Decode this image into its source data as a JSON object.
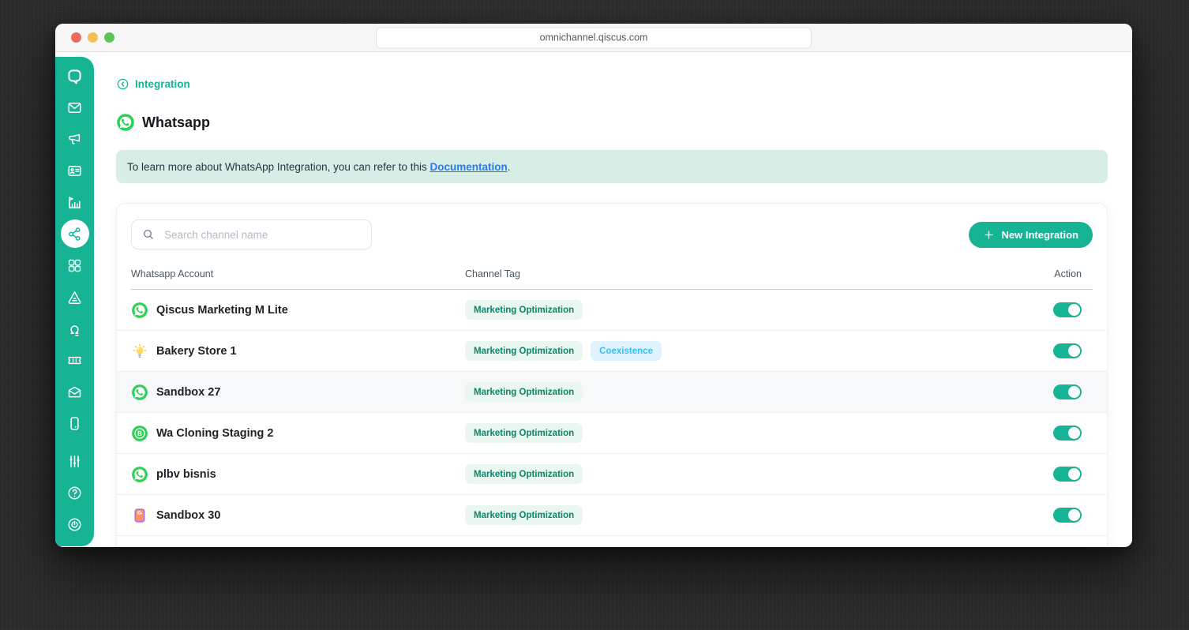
{
  "browser": {
    "url": "omnichannel.qiscus.com"
  },
  "colors": {
    "accent": "#16b394",
    "whatsapp_green": "#2ed157",
    "banner_bg": "#d7eee6",
    "link_blue": "#2879f9"
  },
  "sidebar": {
    "items": [
      {
        "name": "qiscus-logo",
        "group": "top",
        "active": false
      },
      {
        "name": "inbox",
        "group": "top",
        "active": false
      },
      {
        "name": "broadcast",
        "group": "top",
        "active": false
      },
      {
        "name": "contacts",
        "group": "top",
        "active": false
      },
      {
        "name": "analytics",
        "group": "top",
        "active": false
      },
      {
        "name": "integration",
        "group": "top",
        "active": true
      },
      {
        "name": "apps",
        "group": "top",
        "active": false
      },
      {
        "name": "robolabs",
        "group": "top",
        "active": false
      },
      {
        "name": "agent-management",
        "group": "top",
        "active": false
      },
      {
        "name": "ticketing",
        "group": "top",
        "active": false
      },
      {
        "name": "mailbox",
        "group": "top",
        "active": false
      },
      {
        "name": "mobile-app",
        "group": "top",
        "active": false
      },
      {
        "name": "settings",
        "group": "bottom",
        "active": false
      },
      {
        "name": "help",
        "group": "bottom",
        "active": false
      },
      {
        "name": "logout",
        "group": "bottom",
        "active": false
      }
    ]
  },
  "header": {
    "back_label": "Integration",
    "title": "Whatsapp"
  },
  "banner": {
    "text_before": "To learn more about WhatsApp Integration, you can refer to this ",
    "link_label": "Documentation",
    "text_after": "."
  },
  "toolbar": {
    "search_placeholder": "Search channel name",
    "new_integration_label": "New Integration"
  },
  "table": {
    "columns": [
      "Whatsapp Account",
      "Channel Tag",
      "Action"
    ],
    "rows": [
      {
        "name": "Qiscus Marketing M Lite",
        "icon": "whatsapp",
        "tags": [
          "Marketing Optimization"
        ],
        "enabled": true,
        "highlighted": false
      },
      {
        "name": "Bakery Store 1",
        "icon": "lightbulb",
        "tags": [
          "Marketing Optimization",
          "Coexistence"
        ],
        "enabled": true,
        "highlighted": false
      },
      {
        "name": "Sandbox 27",
        "icon": "whatsapp",
        "tags": [
          "Marketing Optimization"
        ],
        "enabled": true,
        "highlighted": true
      },
      {
        "name": "Wa Cloning Staging 2",
        "icon": "whatsapp-business",
        "tags": [
          "Marketing Optimization"
        ],
        "enabled": true,
        "highlighted": false
      },
      {
        "name": "plbv bisnis",
        "icon": "whatsapp",
        "tags": [
          "Marketing Optimization"
        ],
        "enabled": true,
        "highlighted": false
      },
      {
        "name": "Sandbox 30",
        "icon": "orange-notebook",
        "tags": [
          "Marketing Optimization"
        ],
        "enabled": true,
        "highlighted": false
      }
    ]
  },
  "tag_styles": {
    "Marketing Optimization": {
      "bg": "#eaf7f0",
      "color": "#0d8466"
    },
    "Coexistence": {
      "bg": "#def3fd",
      "color": "#35bdf8"
    }
  }
}
